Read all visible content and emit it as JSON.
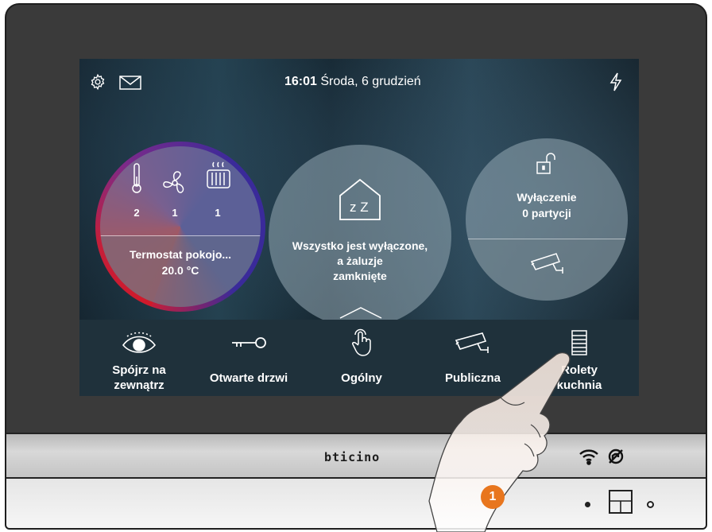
{
  "status_bar": {
    "time": "16:01",
    "date": "Środa, 6 grudzień",
    "icons": [
      "gear-icon",
      "mail-icon",
      "flash-icon"
    ]
  },
  "thermostat_widget": {
    "counts": [
      {
        "icon": "thermometer-icon",
        "value": "2"
      },
      {
        "icon": "fan-icon",
        "value": "1"
      },
      {
        "icon": "radiator-icon",
        "value": "1"
      }
    ],
    "name": "Termostat pokojo...",
    "temperature": "20.0 °C"
  },
  "scenario_widget": {
    "icon": "house-sleep-icon",
    "house_text": "z Z",
    "text_line1": "Wszystko jest wyłączone,",
    "text_line2": "a żaluzje",
    "text_line3": "zamknięte"
  },
  "alarm_widget": {
    "icon": "unlocked-padlock-icon",
    "line1": "Wyłączenie",
    "line2": "0 partycji",
    "camera_icon": "camera-icon"
  },
  "favorites": [
    {
      "icon": "eye-icon",
      "line1": "Spójrz na",
      "line2": "zewnątrz"
    },
    {
      "icon": "key-icon",
      "line1": "Otwarte drzwi",
      "line2": ""
    },
    {
      "icon": "touch-hand-icon",
      "line1": "Ogólny",
      "line2": ""
    },
    {
      "icon": "camera-icon",
      "line1": "Publiczna",
      "line2": ""
    },
    {
      "icon": "shutter-icon",
      "line1": "Rolety",
      "line2": "kuchnia"
    }
  ],
  "device": {
    "brand": "bticino",
    "icons": [
      "wifi-icon",
      "mute-icon"
    ],
    "step_badge": "1"
  },
  "colors": {
    "accent_red": "#d11a2a",
    "accent_purple": "#3a2a9a",
    "step_badge": "#e8761e",
    "bottom_bar": "#1f313b"
  }
}
